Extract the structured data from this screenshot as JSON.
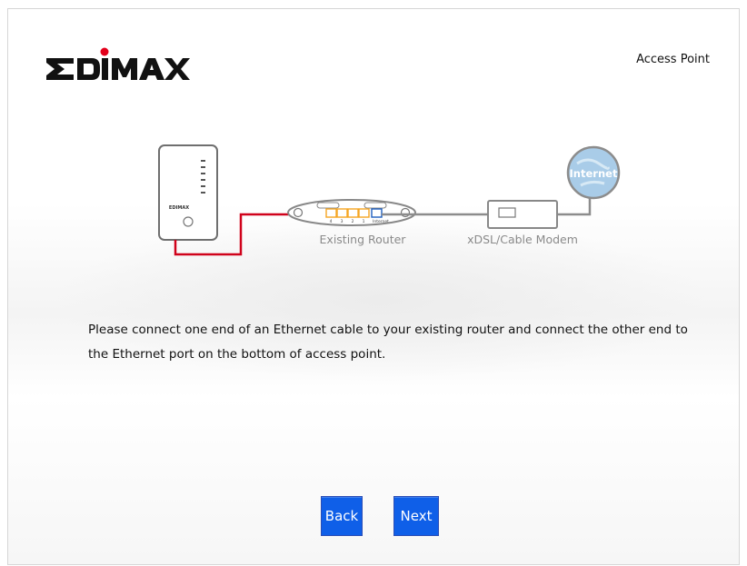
{
  "header": {
    "brand": "EDIMAX",
    "mode_label": "Access Point"
  },
  "diagram": {
    "device_brand": "EDIMAX",
    "router_label": "Existing Router",
    "router_ports": [
      "4",
      "3",
      "2",
      "1",
      "Internet"
    ],
    "modem_label": "xDSL/Cable Modem",
    "internet_label": "Internet"
  },
  "main": {
    "instructions": "Please connect one end of an Ethernet cable to your existing router and connect the other end to the Ethernet port on the bottom of access point."
  },
  "buttons": {
    "back_label": "Back",
    "next_label": "Next"
  },
  "colors": {
    "button_bg": "#0f5fe8",
    "cable": "#d0021b",
    "router_ports": "#f5a623",
    "internet_port": "#1f5fbf",
    "globe": "#a9cce8"
  }
}
